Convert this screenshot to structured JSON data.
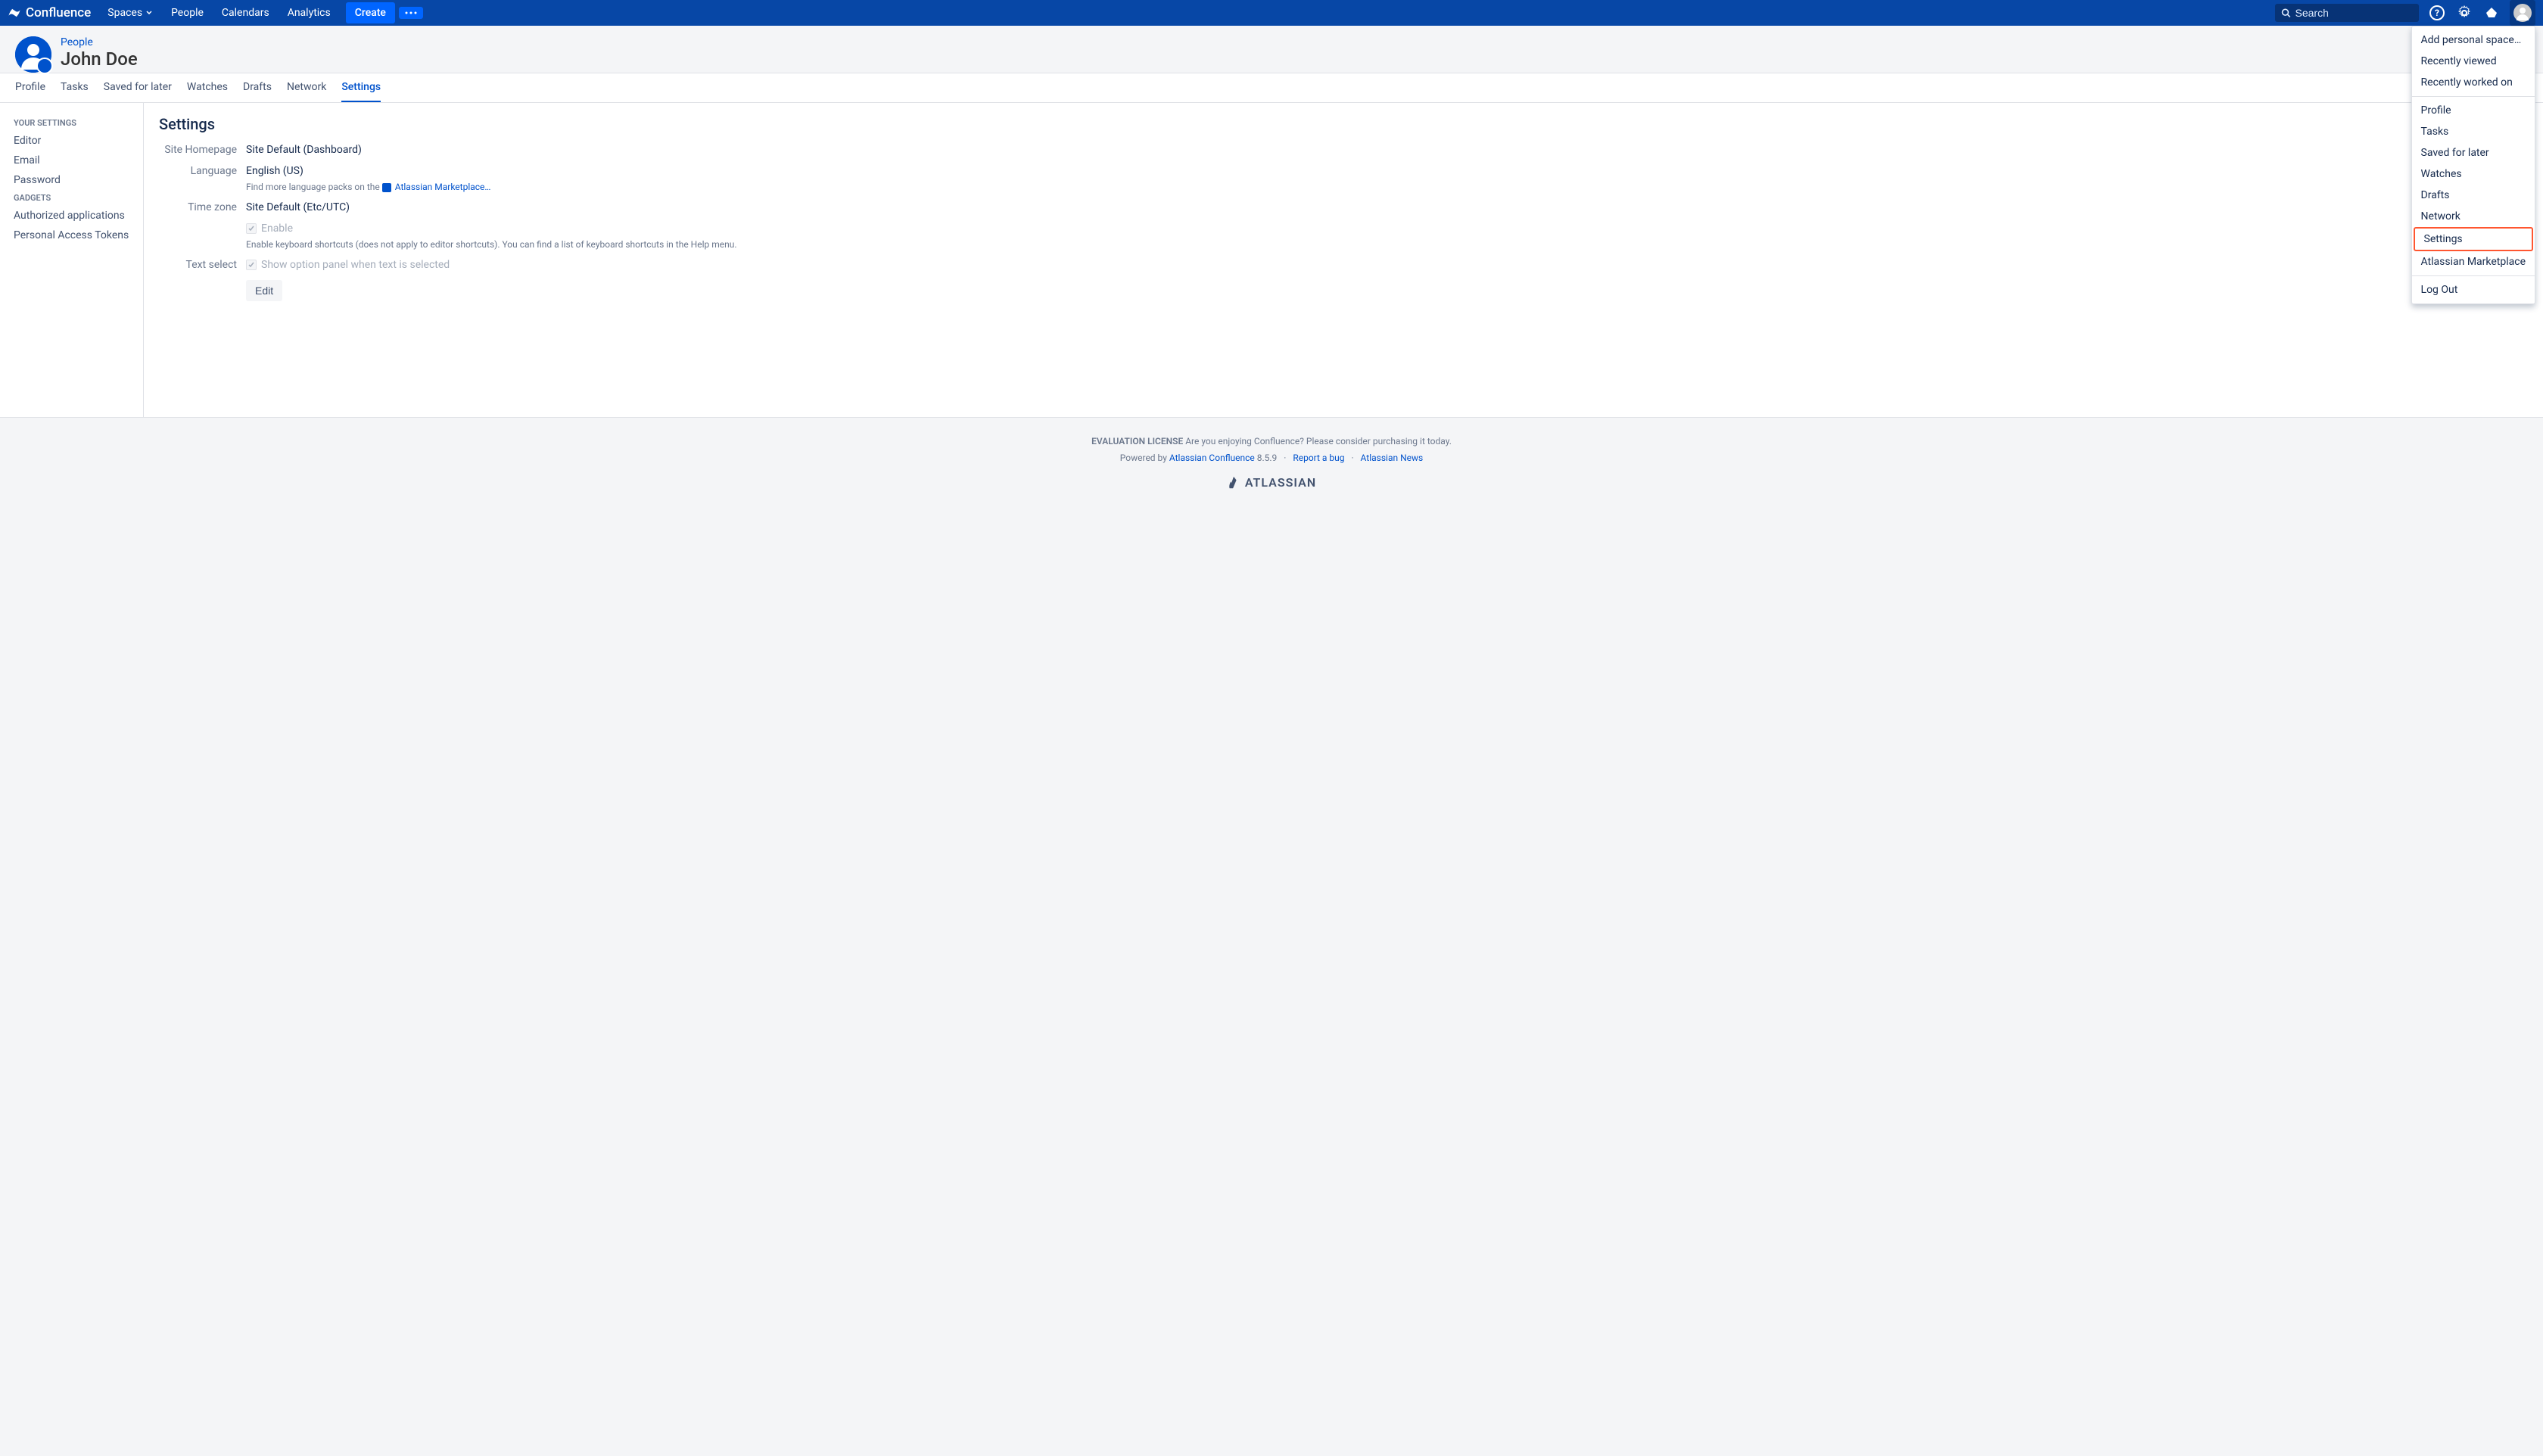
{
  "nav": {
    "logo": "Confluence",
    "items": [
      "Spaces",
      "People",
      "Calendars",
      "Analytics"
    ],
    "create": "Create",
    "search_placeholder": "Search"
  },
  "header": {
    "breadcrumb": "People",
    "title": "John Doe"
  },
  "tabs": [
    "Profile",
    "Tasks",
    "Saved for later",
    "Watches",
    "Drafts",
    "Network",
    "Settings"
  ],
  "active_tab": "Settings",
  "sidebar": {
    "heading1": "YOUR SETTINGS",
    "items1": [
      "Editor",
      "Email",
      "Password"
    ],
    "heading2": "GADGETS",
    "items2": [
      "Authorized applications",
      "Personal Access Tokens"
    ]
  },
  "settings": {
    "title": "Settings",
    "rows": {
      "site_homepage": {
        "label": "Site Homepage",
        "value": "Site Default (Dashboard)"
      },
      "language": {
        "label": "Language",
        "value": "English (US)",
        "help_prefix": "Find more language packs on the ",
        "help_link": "Atlassian Marketplace…"
      },
      "timezone": {
        "label": "Time zone",
        "value": "Site Default (Etc/UTC)"
      },
      "keyboard": {
        "label": "",
        "checkbox": "Enable",
        "help": "Enable keyboard shortcuts (does not apply to editor shortcuts). You can find a list of keyboard shortcuts in the Help menu."
      },
      "text_select": {
        "label": "Text select",
        "checkbox": "Show option panel when text is selected"
      }
    },
    "edit_button": "Edit"
  },
  "dropdown": {
    "items1": [
      "Add personal space…",
      "Recently viewed",
      "Recently worked on"
    ],
    "items2": [
      "Profile",
      "Tasks",
      "Saved for later",
      "Watches",
      "Drafts",
      "Network",
      "Settings",
      "Atlassian Marketplace"
    ],
    "items3": [
      "Log Out"
    ],
    "highlighted": "Settings"
  },
  "footer": {
    "license_bold": "EVALUATION LICENSE",
    "license_text": " Are you enjoying Confluence? Please consider purchasing it today.",
    "powered_prefix": "Powered by ",
    "powered_link": "Atlassian Confluence",
    "version": " 8.5.9",
    "sep": "·",
    "report_bug": "Report a bug",
    "news": "Atlassian News",
    "atlassian": "ATLASSIAN"
  }
}
